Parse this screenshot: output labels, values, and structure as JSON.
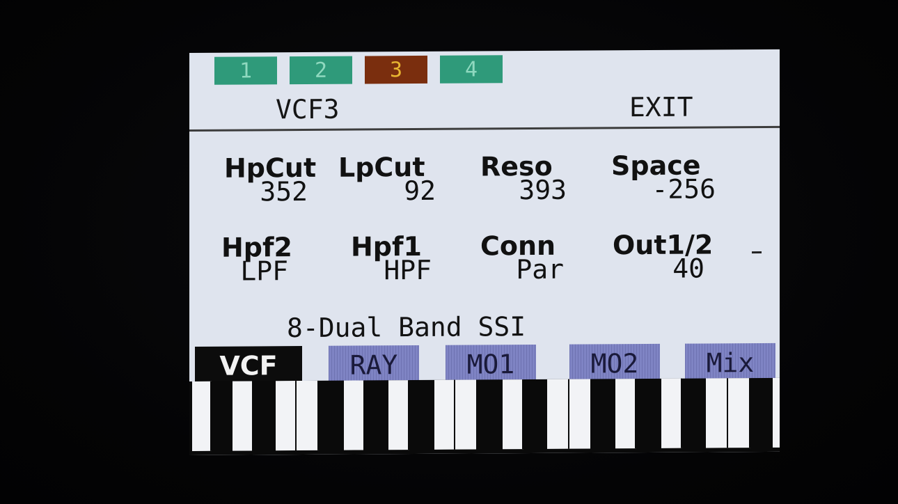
{
  "tabs": [
    {
      "label": "1",
      "color": "#2f9a7a",
      "text_color": "#8fd9bf"
    },
    {
      "label": "2",
      "color": "#2f9a7a",
      "text_color": "#8fd9bf"
    },
    {
      "label": "3",
      "color": "#7a2e0e",
      "text_color": "#e8b531"
    },
    {
      "label": "4",
      "color": "#2f9a7a",
      "text_color": "#8fd9bf"
    }
  ],
  "header": {
    "title": "VCF3",
    "exit_label": "EXIT"
  },
  "params": {
    "row1": [
      {
        "label": "HpCut",
        "value": "352"
      },
      {
        "label": "LpCut",
        "value": "92"
      },
      {
        "label": "Reso",
        "value": "393"
      },
      {
        "label": "Space",
        "value": "-256"
      }
    ],
    "row2": [
      {
        "label": "Hpf2",
        "value": "LPF"
      },
      {
        "label": "Hpf1",
        "value": "HPF"
      },
      {
        "label": "Conn",
        "value": "Par"
      },
      {
        "label": "Out1/2",
        "value": "40"
      }
    ]
  },
  "algorithm": "8-Dual Band SSI",
  "menu": [
    {
      "label": "VCF",
      "active": true
    },
    {
      "label": "RAY",
      "active": false
    },
    {
      "label": "MO1",
      "active": false
    },
    {
      "label": "MO2",
      "active": false
    },
    {
      "label": "Mix",
      "active": false
    }
  ],
  "colors": {
    "screen_bg": "#dfe4ee",
    "menu_inactive": "#7f84c4",
    "menu_active": "#0c0c0c"
  }
}
